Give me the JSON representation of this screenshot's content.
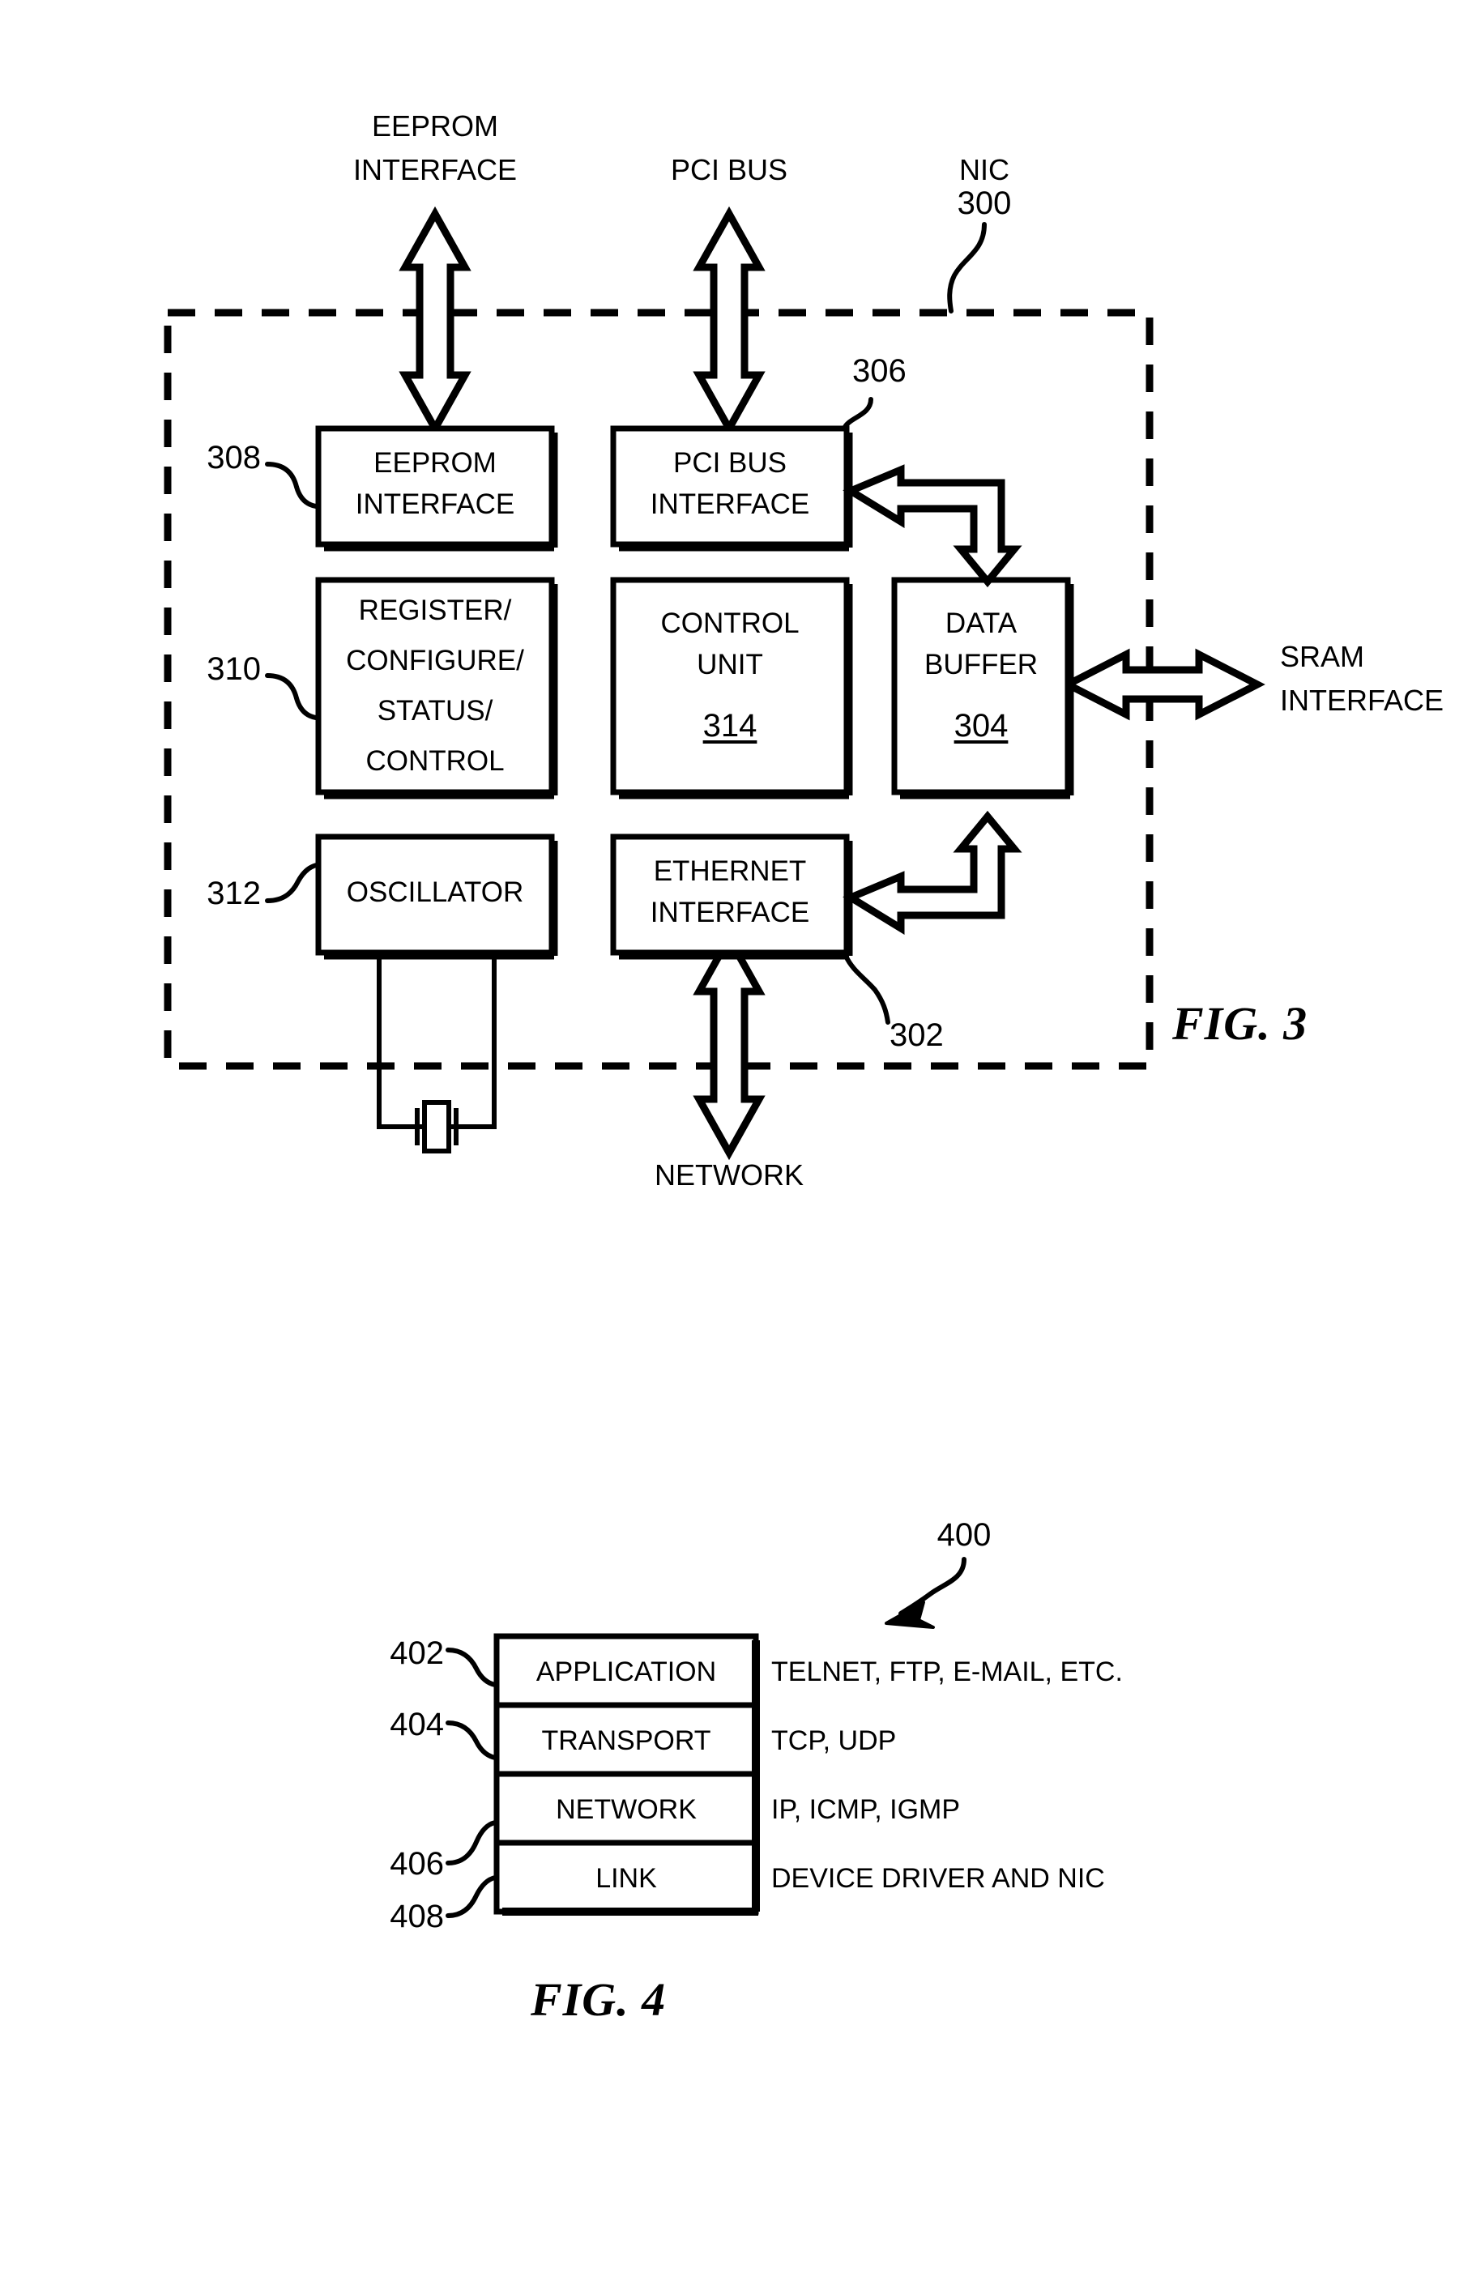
{
  "figure3": {
    "caption": "FIG. 3",
    "enclosure_label": "NIC",
    "enclosure_ref": "300",
    "external_ports": [
      {
        "name": "eeprom-interface-port",
        "label_line1": "EEPROM",
        "label_line2": "INTERFACE",
        "direction": "bidirectional"
      },
      {
        "name": "pci-bus-port",
        "label_line1": "PCI BUS",
        "label_line2": "",
        "direction": "bidirectional"
      },
      {
        "name": "sram-interface-port",
        "label_line1": "SRAM",
        "label_line2": "INTERFACE",
        "direction": "bidirectional"
      },
      {
        "name": "network-port",
        "label_line1": "NETWORK",
        "label_line2": "",
        "direction": "bidirectional"
      }
    ],
    "blocks": [
      {
        "id": "eeprom-interface",
        "lines": [
          "EEPROM",
          "INTERFACE"
        ],
        "ref": "308",
        "ref_side": "left",
        "inner_ref": ""
      },
      {
        "id": "pci-bus-interface",
        "lines": [
          "PCI BUS",
          "INTERFACE"
        ],
        "ref": "306",
        "ref_side": "top-right",
        "inner_ref": ""
      },
      {
        "id": "register-configure-status-control",
        "lines": [
          "REGISTER/",
          "CONFIGURE/",
          "STATUS/",
          "CONTROL"
        ],
        "ref": "310",
        "ref_side": "left",
        "inner_ref": ""
      },
      {
        "id": "control-unit",
        "lines": [
          "CONTROL",
          "UNIT"
        ],
        "ref": "",
        "ref_side": "",
        "inner_ref": "314"
      },
      {
        "id": "data-buffer",
        "lines": [
          "DATA",
          "BUFFER"
        ],
        "ref": "",
        "ref_side": "",
        "inner_ref": "304"
      },
      {
        "id": "oscillator",
        "lines": [
          "OSCILLATOR"
        ],
        "ref": "312",
        "ref_side": "left",
        "inner_ref": ""
      },
      {
        "id": "ethernet-interface",
        "lines": [
          "ETHERNET",
          "INTERFACE"
        ],
        "ref": "302",
        "ref_side": "bottom-right",
        "inner_ref": ""
      }
    ],
    "crystal": {
      "name": "crystal-oscillator-symbol"
    }
  },
  "figure4": {
    "caption": "FIG. 4",
    "stack_ref": "400",
    "layers": [
      {
        "ref": "402",
        "layer": "APPLICATION",
        "protocols": "TELNET, FTP, E-MAIL, ETC."
      },
      {
        "ref": "404",
        "layer": "TRANSPORT",
        "protocols": "TCP, UDP"
      },
      {
        "ref": "406",
        "layer": "NETWORK",
        "protocols": "IP, ICMP, IGMP"
      },
      {
        "ref": "408",
        "layer": "LINK",
        "protocols": "DEVICE DRIVER AND NIC"
      }
    ]
  },
  "colors": {
    "ink": "#000000",
    "paper": "#ffffff"
  }
}
